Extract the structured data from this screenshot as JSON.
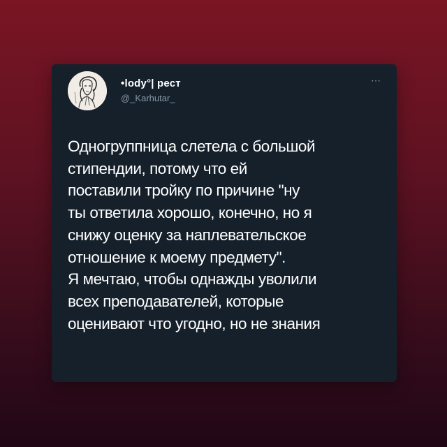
{
  "tweet": {
    "display_name": "•lody°| рест",
    "handle": "@_Karhutar_",
    "more_icon": "⋯",
    "avatar_icon": "sketch-portrait",
    "text_lines": [
      "Одногруппница слетела с большой",
      "стипендии, потому что ей",
      "поставили тройку по причине \"ну",
      "ты ответила хорошо, конечно, но я",
      "снижу оценку за наплевательское",
      "отношение к моему предмету\".",
      "Я мечтаю, чтобы однажды уволили",
      "всех преподавателей, которые",
      "оценивают что угодно, но не знания"
    ]
  },
  "colors": {
    "background_top": "#7a1523",
    "background_bottom": "#200716",
    "card": "#15202b",
    "text": "#ffffff",
    "muted": "#8899a6"
  }
}
